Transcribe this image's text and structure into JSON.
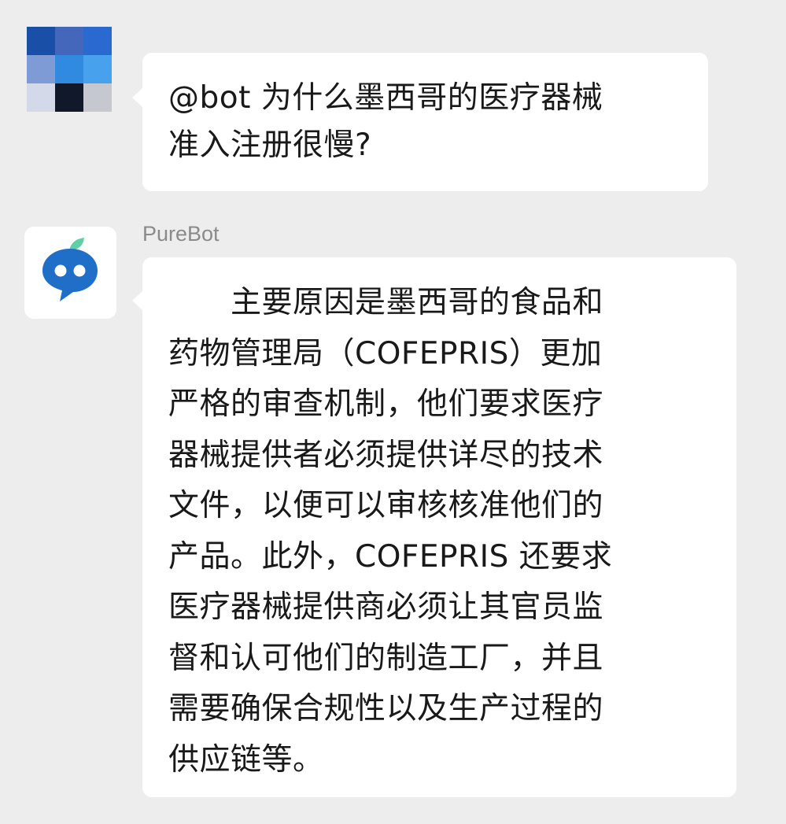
{
  "conversation": {
    "messages": [
      {
        "role": "user",
        "avatar": {
          "icon": "pixelated-avatar-icon",
          "colors": [
            "#1a4fa8",
            "#4466bb",
            "#2a6ad0",
            "#7f9bd6",
            "#2f8ae0",
            "#47a1ec",
            "#d3d9e8",
            "#10182a",
            "#c5c8cf"
          ]
        },
        "lines": [
          "@bot 为什么墨西哥的医疗器械",
          "准入注册很慢?"
        ]
      },
      {
        "role": "bot",
        "sender": "PureBot",
        "avatar": {
          "icon": "chat-bot-icon",
          "colors": {
            "primary": "#1f6fc9",
            "leaf": "#5fcfa8"
          }
        },
        "lines": [
          "　　主要原因是墨西哥的食品和",
          "药物管理局（COFEPRIS）更加",
          "严格的审查机制，他们要求医疗",
          "器械提供者必须提供详尽的技术",
          "文件，以便可以审核核准他们的",
          "产品。此外，COFEPRIS 还要求",
          "医疗器械提供商必须让其官员监",
          "督和认可他们的制造工厂，并且",
          "需要确保合规性以及生产过程的",
          "供应链等。"
        ]
      }
    ]
  }
}
